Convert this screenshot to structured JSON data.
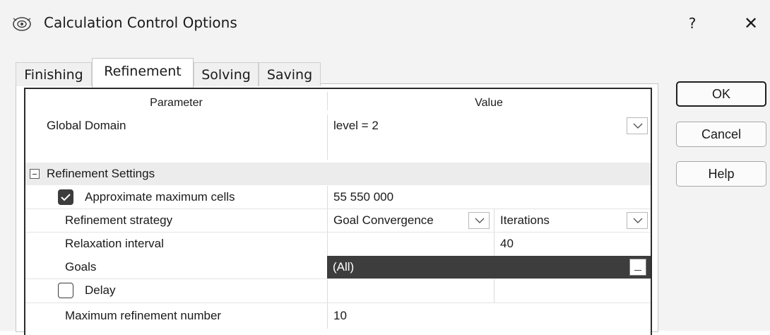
{
  "window": {
    "title": "Calculation Control Options",
    "help_glyph": "?",
    "close_glyph": "✕",
    "icon": "app-settings-icon"
  },
  "tabs": [
    {
      "label": "Finishing",
      "active": false
    },
    {
      "label": "Refinement",
      "active": true
    },
    {
      "label": "Solving",
      "active": false
    },
    {
      "label": "Saving",
      "active": false
    }
  ],
  "grid": {
    "header": {
      "parameter": "Parameter",
      "value": "Value"
    },
    "global_domain": {
      "label": "Global Domain",
      "value": "level = 2"
    },
    "section": {
      "label": "Refinement Settings",
      "expanded": true
    },
    "approx_cells": {
      "label": "Approximate maximum cells",
      "checked": true,
      "value": "55 550 000"
    },
    "strategy": {
      "label": "Refinement strategy",
      "value": "Goal Convergence",
      "value2": "Iterations"
    },
    "relaxation": {
      "label": "Relaxation interval",
      "value": "40"
    },
    "goals": {
      "label": "Goals",
      "value": "(All)"
    },
    "delay": {
      "label": "Delay",
      "checked": false
    },
    "max_refinement": {
      "label": "Maximum refinement number",
      "value": "10"
    }
  },
  "buttons": {
    "ok": "OK",
    "cancel": "Cancel",
    "help": "Help"
  },
  "colors": {
    "selected_row": "#3d3d3d",
    "checkbox_checked": "#3c3c3c"
  }
}
